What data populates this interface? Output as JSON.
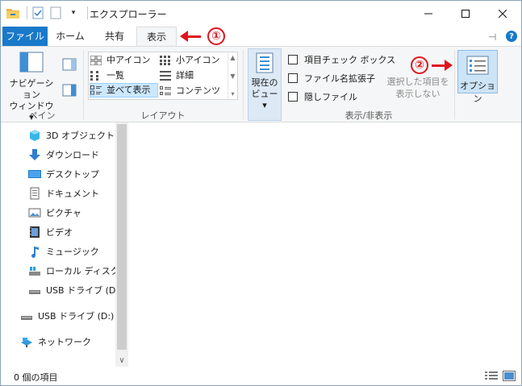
{
  "window": {
    "title": "エクスプローラー"
  },
  "tabs": {
    "file": "ファイル",
    "home": "ホーム",
    "share": "共有",
    "view": "表示"
  },
  "annotations": {
    "marker1": "①",
    "marker2": "②",
    "color": "#e0141e"
  },
  "ribbon": {
    "pane": {
      "nav_pane_label_line1": "ナビゲーション",
      "nav_pane_label_line2": "ウィンドウ ▾",
      "group_label": "ペイン"
    },
    "layout": {
      "items": {
        "medium_icons": "中アイコン",
        "small_icons": "小アイコン",
        "list": "一覧",
        "details": "詳細",
        "tiles": "並べて表示",
        "content": "コンテンツ"
      },
      "group_label": "レイアウト"
    },
    "current_view": {
      "label_line1": "現在の",
      "label_line2": "ビュー ▾"
    },
    "show_hide": {
      "item_checkboxes": "項目チェック ボックス",
      "file_extensions": "ファイル名拡張子",
      "hidden_items": "隠しファイル",
      "hide_selected_line1": "選択した項目を",
      "hide_selected_line2": "表示しない",
      "group_label": "表示/非表示"
    },
    "options": {
      "label": "オプション"
    }
  },
  "nav": {
    "items": [
      {
        "label": "3D オブジェクト",
        "icon": "3d-objects-icon"
      },
      {
        "label": "ダウンロード",
        "icon": "download-icon"
      },
      {
        "label": "デスクトップ",
        "icon": "desktop-icon"
      },
      {
        "label": "ドキュメント",
        "icon": "documents-icon"
      },
      {
        "label": "ピクチャ",
        "icon": "pictures-icon"
      },
      {
        "label": "ビデオ",
        "icon": "videos-icon"
      },
      {
        "label": "ミュージック",
        "icon": "music-icon"
      },
      {
        "label": "ローカル ディスク (C",
        "icon": "local-disk-icon"
      },
      {
        "label": "USB ドライブ (D:)",
        "icon": "usb-drive-icon"
      }
    ],
    "usb_root": "USB ドライブ (D:)",
    "network": "ネットワーク"
  },
  "status": {
    "item_count": "0 個の項目"
  },
  "colors": {
    "file_tab": "#1979ca",
    "ribbon_bg": "#f5f6f7",
    "selected": "#cce8ff"
  }
}
